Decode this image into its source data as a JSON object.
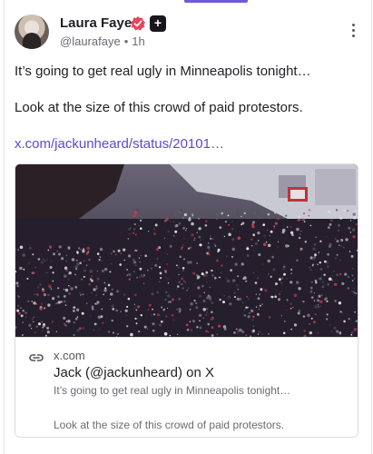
{
  "colors": {
    "accent": "#6e5ad8",
    "link": "#5a4bd1",
    "verified": "#e8445a"
  },
  "author": {
    "name": "Laura Faye",
    "handle": "@laurafaye",
    "time": "1h",
    "verified_icon": "verified-badge-icon",
    "plus_badge": "+"
  },
  "post": {
    "line1": "It’s going to get real ugly in Minneapolis tonight…",
    "line2": "Look at the size of this crowd of paid protestors.",
    "link_text": "x.com/jackunheard/status/20101…"
  },
  "embed": {
    "image_alt_icon": "crowd-photo",
    "domain": "x.com",
    "title": "Jack (@jackunheard) on X",
    "desc_line1": "It’s going to get real ugly in Minneapolis tonight…",
    "desc_line2": "Look at the size of this crowd of paid protestors."
  }
}
